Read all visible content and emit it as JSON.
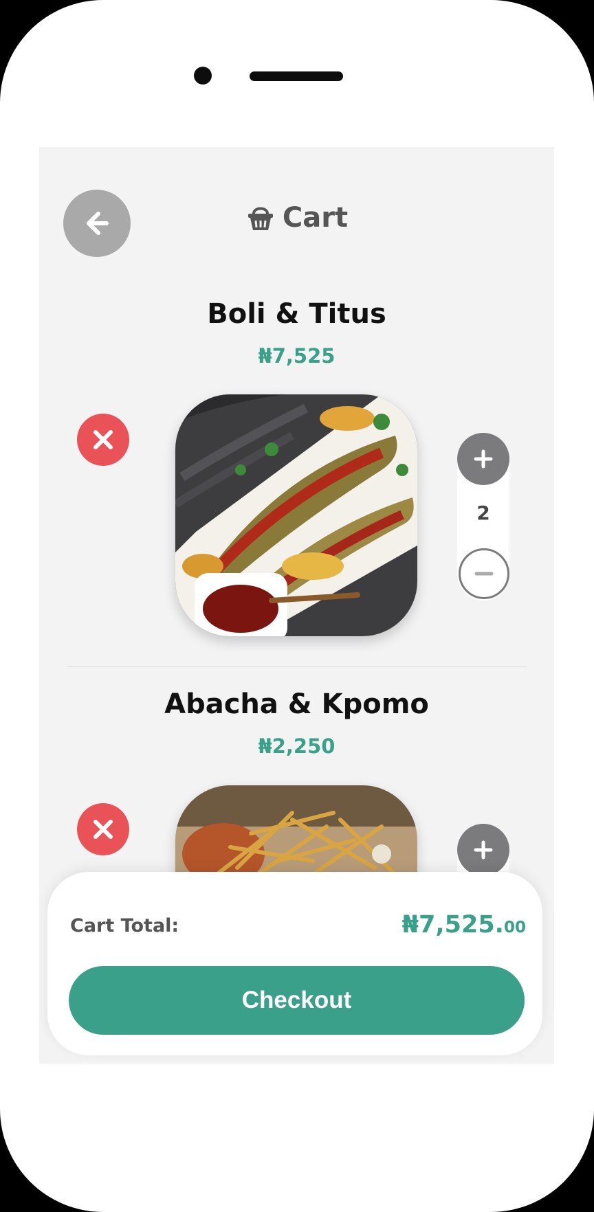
{
  "header": {
    "title": "Cart"
  },
  "cart_items": [
    {
      "name": "Boli & Titus",
      "price": "₦7,525",
      "quantity": "2"
    },
    {
      "name": "Abacha & Kpomo",
      "price": "₦2,250"
    }
  ],
  "footer": {
    "total_label": "Cart Total:",
    "total_main": "₦7,525.",
    "total_cents": "00",
    "checkout_label": "Checkout"
  },
  "colors": {
    "accent": "#3aa08a",
    "remove": "#e95257",
    "icon_gray": "#a9a9aa"
  }
}
